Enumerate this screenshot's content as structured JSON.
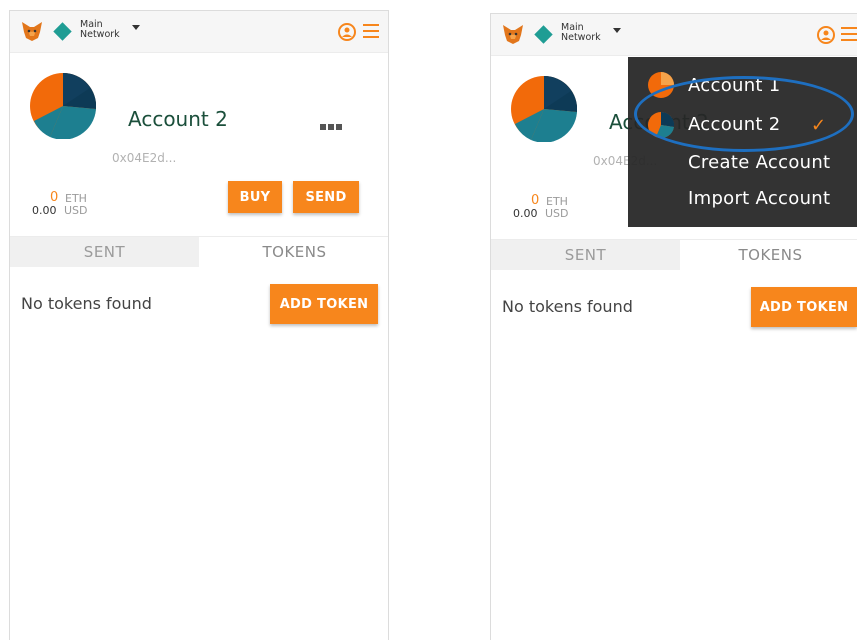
{
  "network": {
    "label_line1": "Main",
    "label_line2": "Network"
  },
  "account": {
    "name": "Account 2",
    "address": "0x04E2d...",
    "eth_amount": "0",
    "eth_unit": "ETH",
    "usd_amount": "0.00",
    "usd_unit": "USD"
  },
  "buttons": {
    "buy": "BUY",
    "send": "SEND",
    "add_token": "ADD TOKEN"
  },
  "tabs": [
    {
      "label": "SENT"
    },
    {
      "label": "TOKENS"
    }
  ],
  "tokens": {
    "empty_message": "No tokens found"
  },
  "dropdown": {
    "items": [
      {
        "label": "Account 1"
      },
      {
        "label": "Account 2",
        "check": "✓"
      },
      {
        "label": "Create Account"
      },
      {
        "label": "Import Account"
      }
    ]
  },
  "colors": {
    "accent": "#f7861c",
    "network": "#1f9d94",
    "highlight": "#1e6fc0"
  }
}
